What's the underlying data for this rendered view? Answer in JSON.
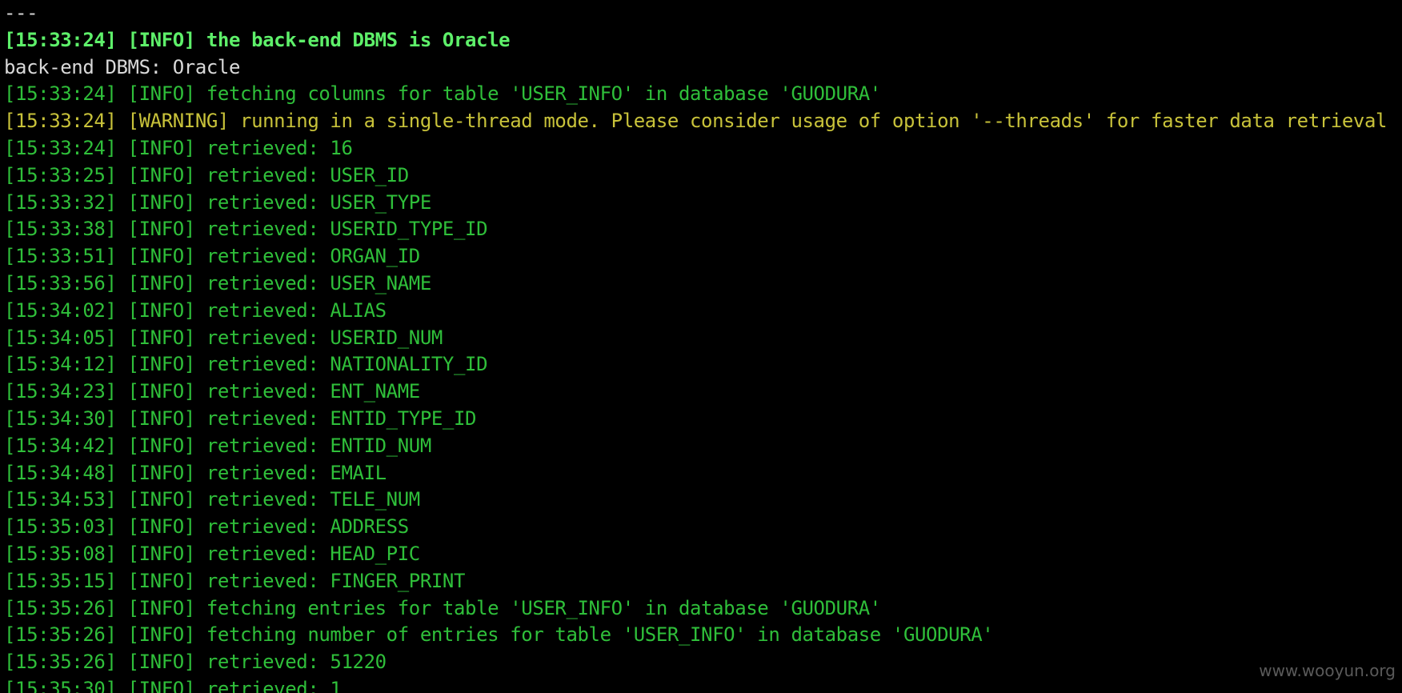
{
  "terminal": {
    "lines": [
      {
        "text": "---",
        "style": "dash"
      },
      {
        "text": "[15:33:24] [INFO] the back-end DBMS is Oracle",
        "style": "green-bold"
      },
      {
        "text": "back-end DBMS: Oracle",
        "style": "white"
      },
      {
        "text": "[15:33:24] [INFO] fetching columns for table 'USER_INFO' in database 'GUODURA'",
        "style": "green"
      },
      {
        "text": "[15:33:24] [WARNING] running in a single-thread mode. Please consider usage of option '--threads' for faster data retrieval",
        "style": "yellow"
      },
      {
        "text": "[15:33:24] [INFO] retrieved: 16",
        "style": "green"
      },
      {
        "text": "[15:33:25] [INFO] retrieved: USER_ID",
        "style": "green"
      },
      {
        "text": "[15:33:32] [INFO] retrieved: USER_TYPE",
        "style": "green"
      },
      {
        "text": "[15:33:38] [INFO] retrieved: USERID_TYPE_ID",
        "style": "green"
      },
      {
        "text": "[15:33:51] [INFO] retrieved: ORGAN_ID",
        "style": "green"
      },
      {
        "text": "[15:33:56] [INFO] retrieved: USER_NAME",
        "style": "green"
      },
      {
        "text": "[15:34:02] [INFO] retrieved: ALIAS",
        "style": "green"
      },
      {
        "text": "[15:34:05] [INFO] retrieved: USERID_NUM",
        "style": "green"
      },
      {
        "text": "[15:34:12] [INFO] retrieved: NATIONALITY_ID",
        "style": "green"
      },
      {
        "text": "[15:34:23] [INFO] retrieved: ENT_NAME",
        "style": "green"
      },
      {
        "text": "[15:34:30] [INFO] retrieved: ENTID_TYPE_ID",
        "style": "green"
      },
      {
        "text": "[15:34:42] [INFO] retrieved: ENTID_NUM",
        "style": "green"
      },
      {
        "text": "[15:34:48] [INFO] retrieved: EMAIL",
        "style": "green"
      },
      {
        "text": "[15:34:53] [INFO] retrieved: TELE_NUM",
        "style": "green"
      },
      {
        "text": "[15:35:03] [INFO] retrieved: ADDRESS",
        "style": "green"
      },
      {
        "text": "[15:35:08] [INFO] retrieved: HEAD_PIC",
        "style": "green"
      },
      {
        "text": "[15:35:15] [INFO] retrieved: FINGER_PRINT",
        "style": "green"
      },
      {
        "text": "[15:35:26] [INFO] fetching entries for table 'USER_INFO' in database 'GUODURA'",
        "style": "green"
      },
      {
        "text": "[15:35:26] [INFO] fetching number of entries for table 'USER_INFO' in database 'GUODURA'",
        "style": "green"
      },
      {
        "text": "[15:35:26] [INFO] retrieved: 51220",
        "style": "green"
      },
      {
        "text": "[15:35:30] [INFO] retrieved: 1",
        "style": "green"
      }
    ],
    "watermark": "www.wooyun.org"
  },
  "colors": {
    "background": "#000000",
    "info_green": "#2fbf3a",
    "info_green_bold": "#5ef06a",
    "warning_yellow": "#c8c23a",
    "plain_text": "#d9d9d9"
  }
}
